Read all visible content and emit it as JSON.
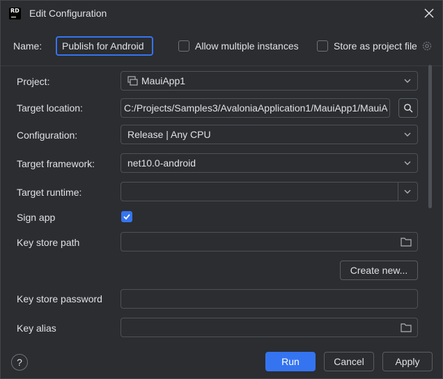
{
  "window": {
    "title": "Edit Configuration",
    "logo_text": "RD"
  },
  "top": {
    "name_label": "Name:",
    "name_value": "Publish for Android",
    "allow_multiple_label": "Allow multiple instances",
    "store_project_label": "Store as project file"
  },
  "form": {
    "project": {
      "label": "Project:",
      "value": "MauiApp1"
    },
    "target_location": {
      "label": "Target location:",
      "value": "C:/Projects/Samples3/AvaloniaApplication1/MauiApp1/MauiA"
    },
    "configuration": {
      "label": "Configuration:",
      "value": "Release | Any CPU"
    },
    "target_framework": {
      "label": "Target framework:",
      "value": "net10.0-android"
    },
    "target_runtime": {
      "label": "Target runtime:",
      "value": ""
    },
    "sign_app": {
      "label": "Sign app",
      "checked": true
    },
    "key_store_path": {
      "label": "Key store path",
      "value": ""
    },
    "create_new_label": "Create new...",
    "key_store_password": {
      "label": "Key store password",
      "value": ""
    },
    "key_alias": {
      "label": "Key alias",
      "value": ""
    }
  },
  "footer": {
    "help_label": "?",
    "run_label": "Run",
    "cancel_label": "Cancel",
    "apply_label": "Apply"
  },
  "colors": {
    "accent": "#3574f0",
    "background": "#2b2d30",
    "text": "#dfe1e5"
  }
}
